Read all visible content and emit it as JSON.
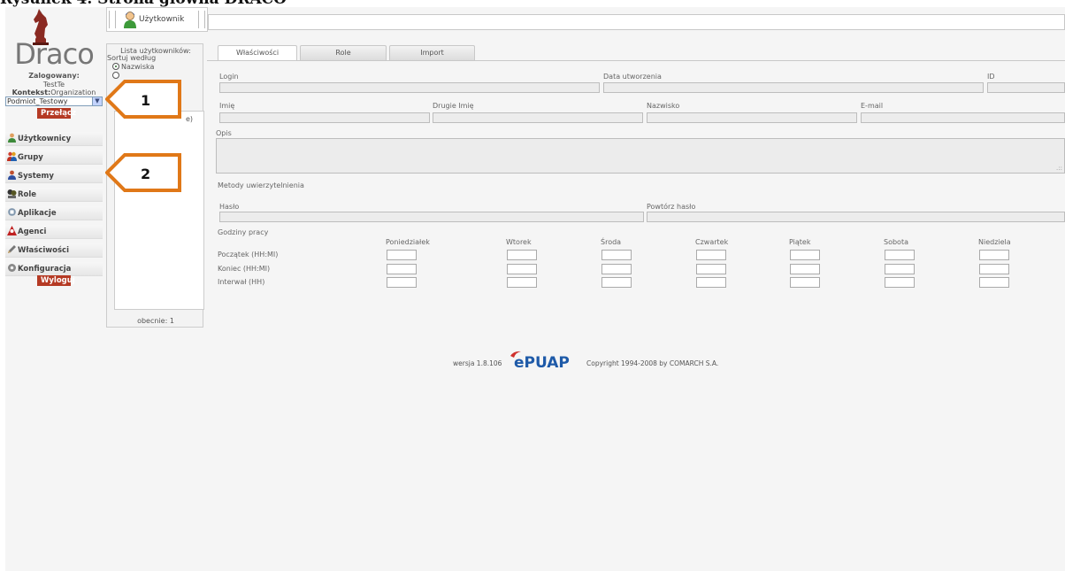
{
  "caption": "Rysunek 4. Strona główna DRACO",
  "app": {
    "logo_text": "Draco",
    "logged_label": "Zalogowany:",
    "logged_user": "TestTe",
    "context_label": "Kontekst:",
    "context_value": "Organization",
    "context_select": "Podmiot_Testowy",
    "switch_button": "Przełącz",
    "logout_button": "Wyloguj",
    "nav": [
      {
        "label": "Użytkownicy",
        "icon": "user-icon"
      },
      {
        "label": "Grupy",
        "icon": "group-icon"
      },
      {
        "label": "Systemy",
        "icon": "system-icon"
      },
      {
        "label": "Role",
        "icon": "role-icon"
      },
      {
        "label": "Aplikacje",
        "icon": "application-icon"
      },
      {
        "label": "Agenci",
        "icon": "agent-icon"
      },
      {
        "label": "Właściwości",
        "icon": "pencil-icon"
      },
      {
        "label": "Konfiguracja",
        "icon": "config-icon"
      }
    ]
  },
  "toolbar": {
    "title": "Użytkownik"
  },
  "user_list": {
    "title": "Lista użytkowników:",
    "sort_label": "Sortuj według",
    "sort_option_1": "Nazwiska",
    "fragment": "e)",
    "count": "obecnie: 1"
  },
  "tabs": [
    "Właściwości",
    "Role",
    "Import"
  ],
  "form": {
    "login": "Login",
    "created": "Data utworzenia",
    "id": "ID",
    "first_name": "Imię",
    "middle_name": "Drugie Imię",
    "last_name": "Nazwisko",
    "email": "E-mail",
    "description": "Opis",
    "auth_methods": "Metody uwierzytelnienia",
    "password": "Hasło",
    "password_repeat": "Powtórz hasło",
    "work_hours": "Godziny pracy",
    "days": [
      "Poniedziałek",
      "Wtorek",
      "Środa",
      "Czwartek",
      "Piątek",
      "Sobota",
      "Niedziela"
    ],
    "rows": [
      "Początek (HH:MI)",
      "Koniec (HH:MI)",
      "Interwał (HH)"
    ]
  },
  "footer": {
    "version": "wersja 1.8.106",
    "logo": "ePUAP",
    "copyright": "Copyright 1994-2008 by COMARCH S.A."
  },
  "callouts": [
    "1",
    "2"
  ],
  "colors": {
    "accent_red": "#b53a24",
    "callout_orange": "#e07818",
    "epuap_red": "#d0312d",
    "epuap_blue": "#1e5aa8"
  }
}
